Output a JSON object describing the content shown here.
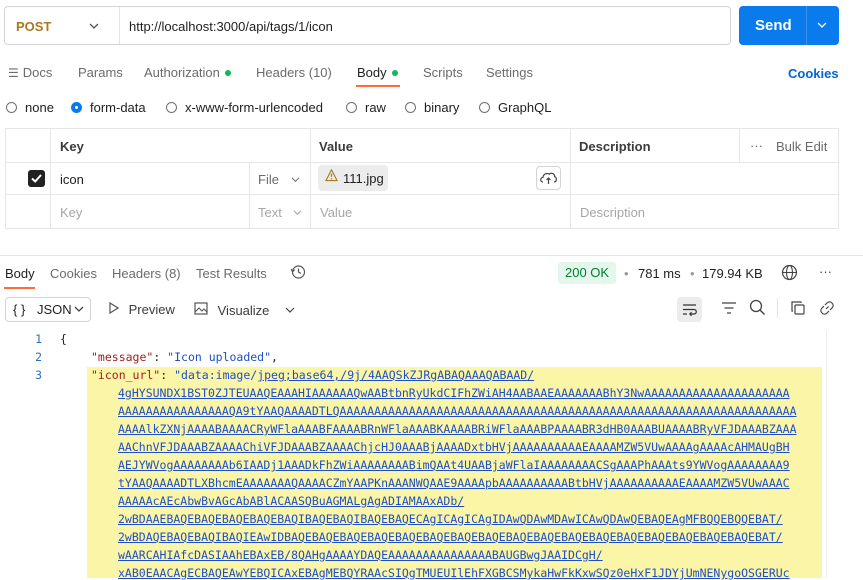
{
  "request": {
    "method": "POST",
    "url": "http://localhost:3000/api/tags/1/icon",
    "send_label": "Send"
  },
  "request_tabs": [
    {
      "label": "Docs"
    },
    {
      "label": "Params"
    },
    {
      "label": "Authorization"
    },
    {
      "label": "Headers (10)"
    },
    {
      "label": "Body"
    },
    {
      "label": "Scripts"
    },
    {
      "label": "Settings"
    }
  ],
  "cookies_link": "Cookies",
  "body_modes": [
    "none",
    "form-data",
    "x-www-form-urlencoded",
    "raw",
    "binary",
    "GraphQL"
  ],
  "selected_body_mode": "form-data",
  "form_table": {
    "headers": {
      "key": "Key",
      "value": "Value",
      "description": "Description",
      "bulk_edit": "Bulk Edit"
    },
    "rows": [
      {
        "checked": true,
        "key": "icon",
        "type": "File",
        "value": "111.jpg",
        "description": ""
      }
    ],
    "placeholder": {
      "key": "Key",
      "type": "Text",
      "value": "Value",
      "description": "Description"
    }
  },
  "response_tabs": [
    {
      "label": "Body"
    },
    {
      "label": "Cookies"
    },
    {
      "label": "Headers (8)"
    },
    {
      "label": "Test Results"
    }
  ],
  "response_meta": {
    "status": "200 OK",
    "time": "781 ms",
    "size": "179.94 KB"
  },
  "response_toolbar": {
    "format": "JSON",
    "preview": "Preview",
    "visualize": "Visualize"
  },
  "json_lines": {
    "line1": "{",
    "message_key": "\"message\"",
    "message_val": "\"Icon uploaded\"",
    "icon_key": "\"icon_url\"",
    "icon_val_start": "\"data:image/",
    "icon_val_rest": "jpeg;base64,/9j/4AAQSkZJRgABAQAAAQABAAD/",
    "base64_lines": [
      "4gHYSUNDX1BST0ZJTEUAAQEAAAHIAAAAAAQwAABtbnRyUkdCIFhZWiAH4AABAAEAAAAAAABhY3NwAAAAAAAAAAAAAAAAAAAAA",
      "AAAAAAAAAAAAAAAAQA9tYAAQAAAADTLQAAAAAAAAAAAAAAAAAAAAAAAAAAAAAAAAAAAAAAAAAAAAAAAAAAAAAAAAAAAAAAAAAA",
      "AAAAlkZXNjAAAABAAAACRyWFlaAAABFAAAABRnWFlaAAABKAAAABRiWFlaAAABPAAAABR3dHB0AAABUAAAABRyVFJDAAABZAAA",
      "AAChnVFJDAAABZAAAAChiVFJDAAABZAAAAChjcHJ0AAABjAAAADxtbHVjAAAAAAAAAAEAAAAMZW5VUwAAAAgAAAAcAHMAUgBH",
      "AEJYWVogAAAAAAAAb6IAADj1AAADkFhZWiAAAAAAAABimQAAt4UAABjaWFlaIAAAAAAAACSgAAAPhAAAts9YWVogAAAAAAAA9",
      "tYAAQAAAADTLXBhcmEAAAAAAAQAAAACZmYAAPKnAAANWQAAE9AAAApbAAAAAAAAAABtbHVjAAAAAAAAAAEAAAAMZW5VUwAAAC",
      "AAAAAcAEcAbwBvAGcAbABlACAASQBuAGMALgAgADIAMAAxADb/",
      "2wBDAAEBAQEBAQEBAQEBAQEBAQIBAQEBAQIBAQEBAQECAgICAgICAgIDAwQDAwMDAwICAwQDAwQEBAQEAgMFBQQEBQQEBAT/",
      "2wBDAQEBAQEBAQIBAQIEAwIDBAQEBAQEBAQEBAQEBAQEBAQEBAQEBAQEBAQEBAQEBAQEBAQEBAQEBAQEBAQEBAQEBAQEBAT/",
      "wAARCAHIAfcDASIAAhEBAxEB/8QAHgAAAAYDAQEAAAAAAAAAAAAAAABAUGBwgJAAIDCgH/",
      "xAB0EAACAgECBAQEAwYEBQICAxEBAgMEBQYRAAcSIQgTMUEUIlEhFXGBCSMykaHwFkKxwSQz0eHxF1JDYjUmNENygoOSGERUc"
    ]
  }
}
